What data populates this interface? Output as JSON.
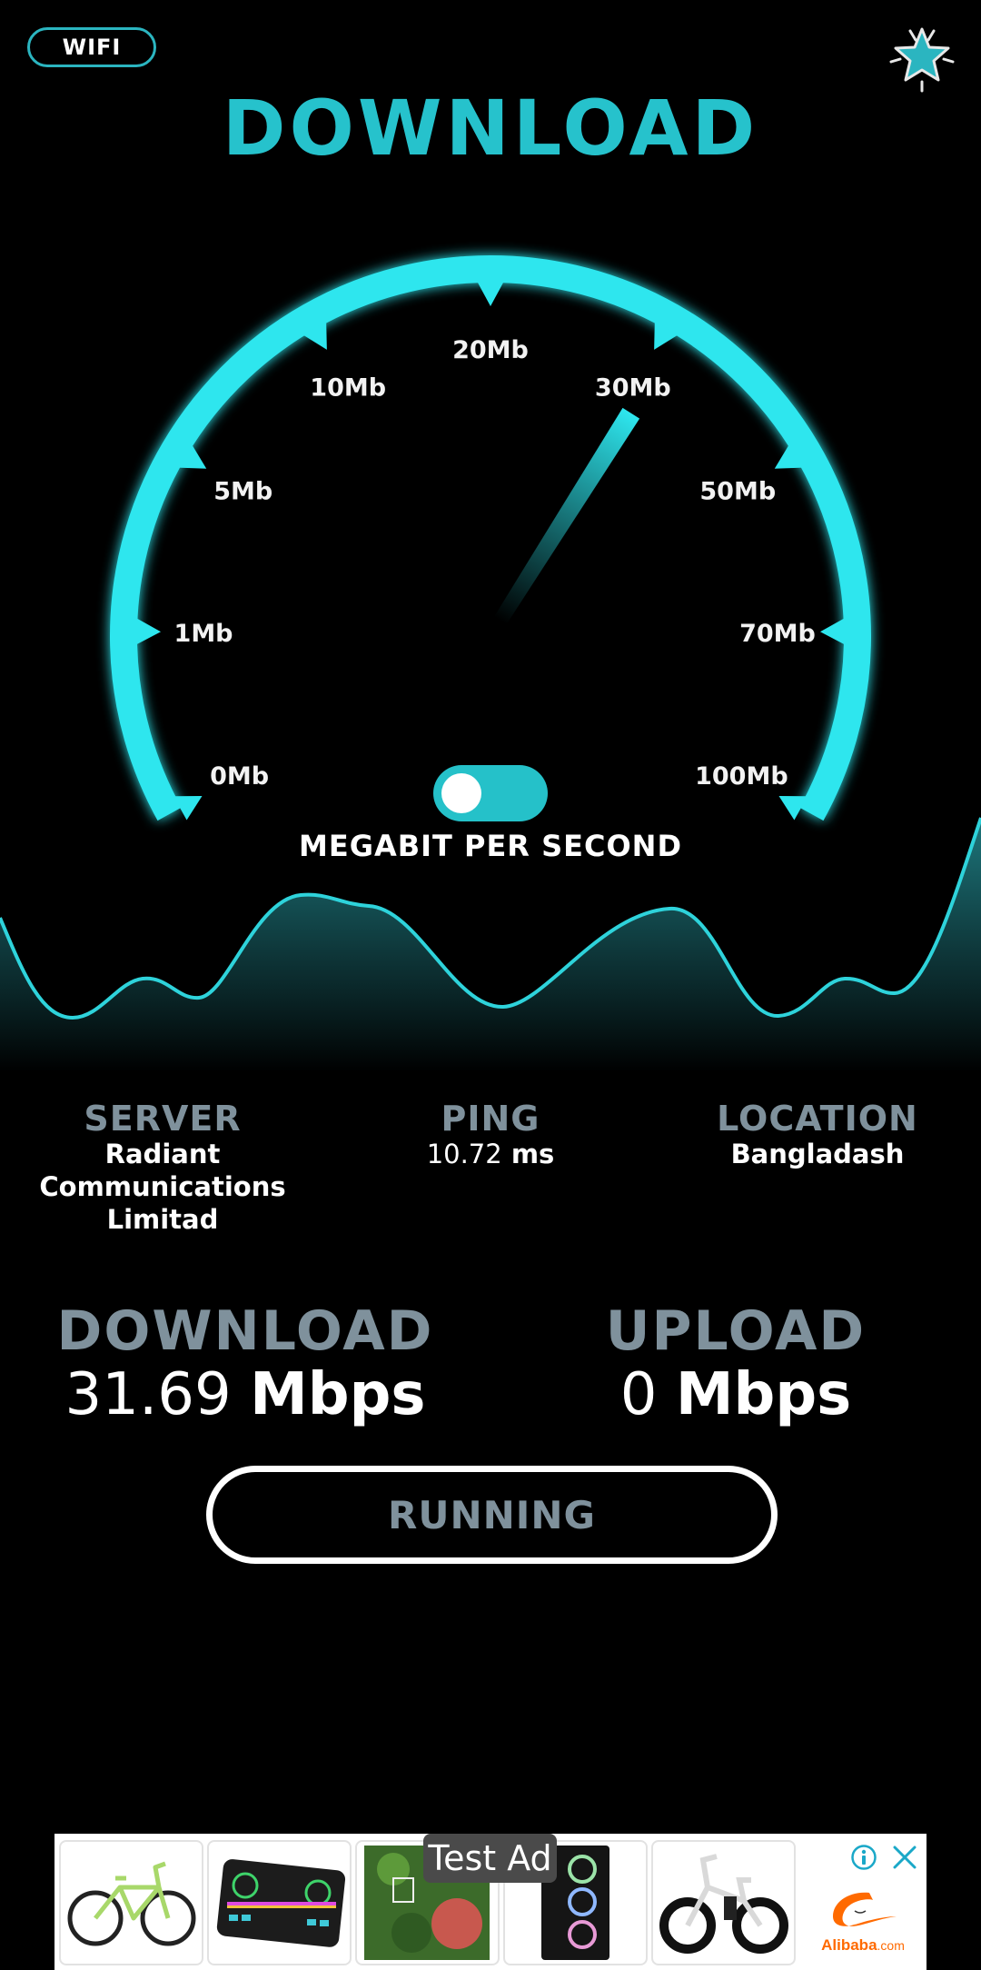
{
  "header": {
    "network_type": "WIFI",
    "title": "DOWNLOAD",
    "rate_icon": "star-icon"
  },
  "gauge": {
    "labels": [
      "0Mb",
      "1Mb",
      "5Mb",
      "10Mb",
      "20Mb",
      "30Mb",
      "50Mb",
      "70Mb",
      "100Mb"
    ],
    "needle_value_mbps": 31.69,
    "accent_color": "#2ee6ee",
    "unit_toggle_on": true,
    "unit_caption": "MEGABIT PER SECOND"
  },
  "info": {
    "server": {
      "label": "SERVER",
      "value_lines": [
        "Radiant",
        "Communications",
        "Limitad"
      ]
    },
    "ping": {
      "label": "PING",
      "value": "10.72",
      "unit": "ms"
    },
    "location": {
      "label": "LOCATION",
      "value": "Bangladash"
    }
  },
  "results": {
    "download": {
      "label": "DOWNLOAD",
      "value": "31.69",
      "unit": "Mbps"
    },
    "upload": {
      "label": "UPLOAD",
      "value": "0",
      "unit": "Mbps"
    }
  },
  "status_button": {
    "label": "RUNNING"
  },
  "ad": {
    "badge": "Test Ad",
    "brand": "Alibaba",
    "brand_suffix": ".com",
    "products": [
      "bicycle",
      "audio mixer",
      "green wall",
      "pc case",
      "electric bike"
    ],
    "info_icon": "info-icon",
    "close_icon": "close-icon"
  },
  "colors": {
    "accent": "#26c2cc",
    "muted_label": "#7f919c",
    "background": "#000000"
  }
}
